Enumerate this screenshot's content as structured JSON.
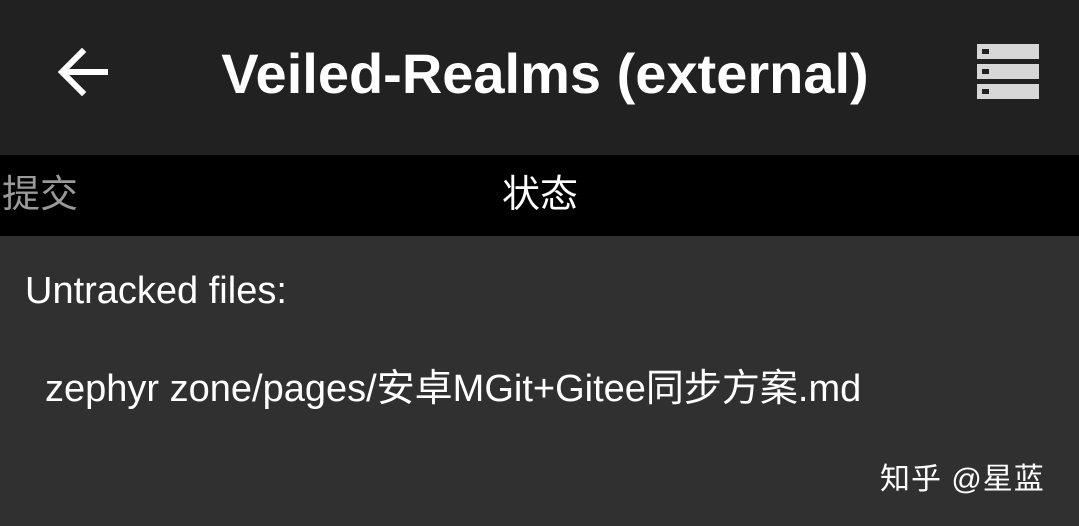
{
  "appbar": {
    "back_icon": "arrow-left-icon",
    "title": "Veiled-Realms (external)",
    "menu_icon": "server-stack-icon"
  },
  "tabs": [
    {
      "label": "提交",
      "selected": false
    },
    {
      "label": "状态",
      "selected": true
    }
  ],
  "status": {
    "section_title": "Untracked files:",
    "files": [
      "zephyr zone/pages/安卓MGit+Gitee同步方案.md"
    ]
  },
  "watermark": "知乎 @星蓝",
  "colors": {
    "appbar_bg": "#212121",
    "tabbar_bg": "#000000",
    "content_bg": "#303030",
    "text_primary": "#ffffff",
    "text_inactive": "#9a9a9a"
  }
}
